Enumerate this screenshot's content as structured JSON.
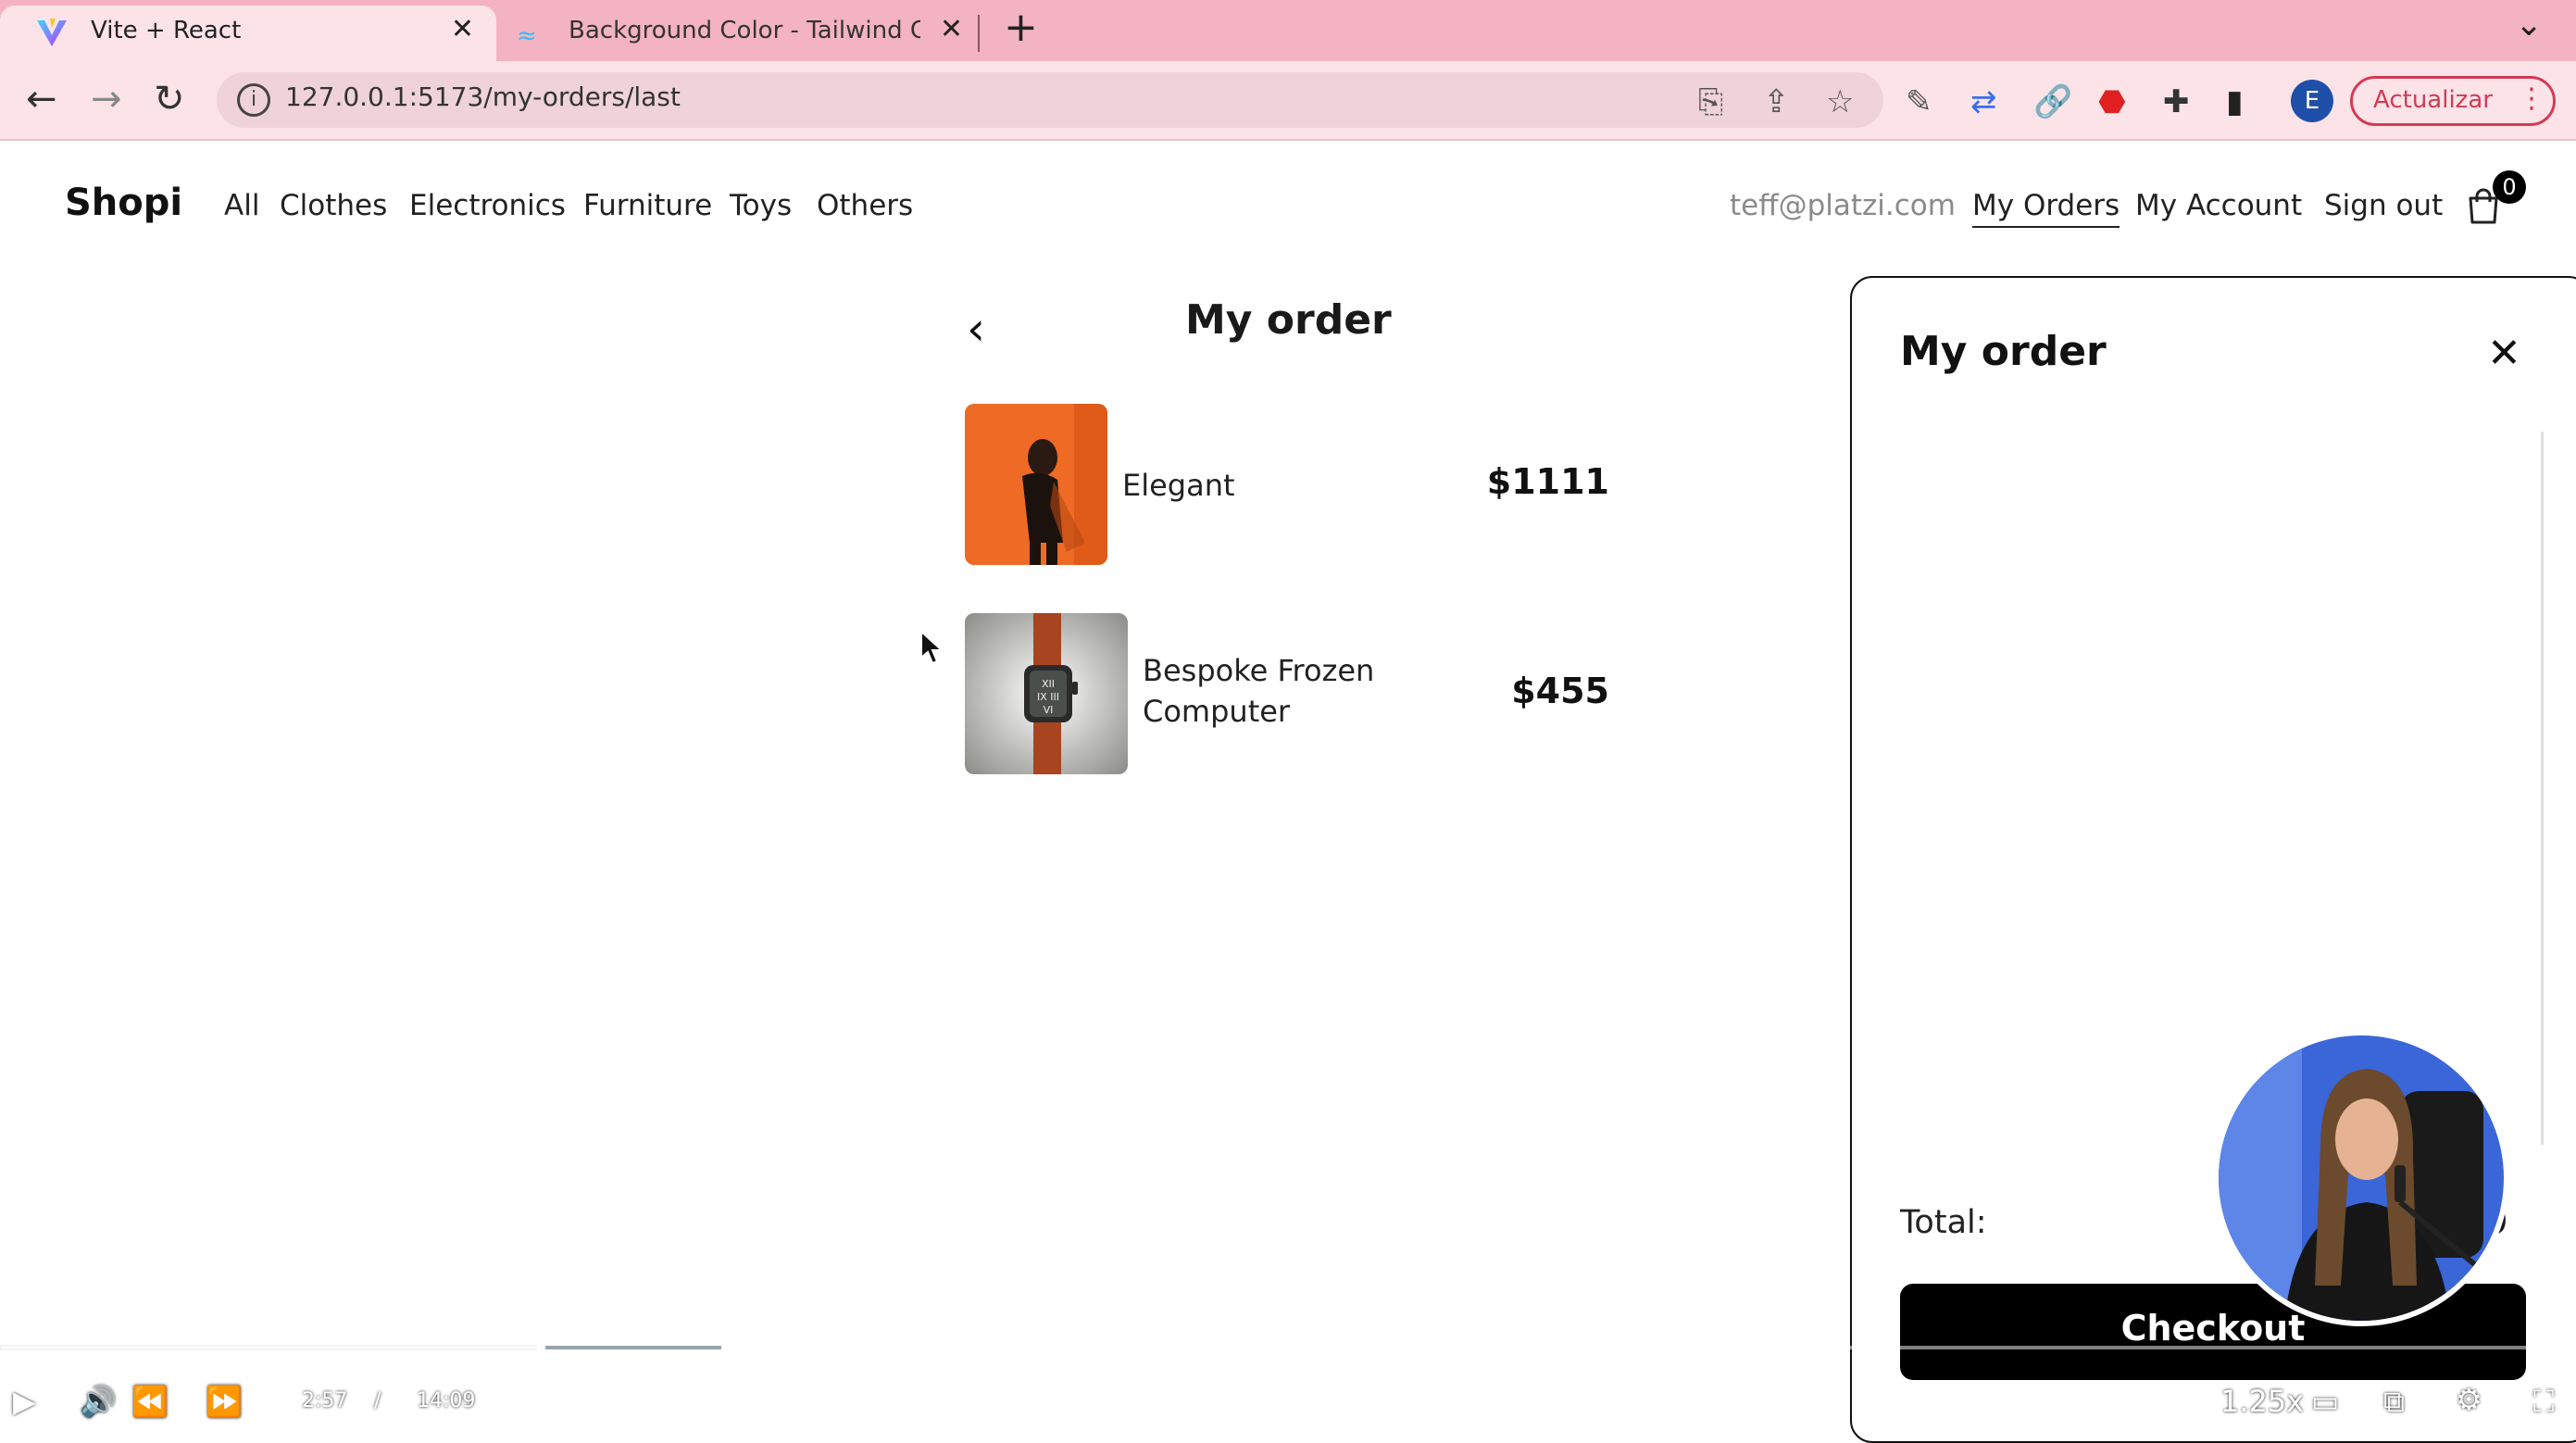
{
  "browser": {
    "tabs": [
      {
        "title": "Vite + React",
        "icon": "vite-icon"
      },
      {
        "title": "Background Color - Tailwind CSS",
        "icon": "tailwind-icon"
      }
    ],
    "url": "127.0.0.1:5173/my-orders/last",
    "update_button": "Actualizar",
    "profile_initial": "E",
    "colors": {
      "tab_strip": "#f4b3c2",
      "toolbar": "#fbe3e8",
      "update_red": "#d33a55"
    }
  },
  "nav": {
    "brand": "Shopi",
    "categories": [
      "All",
      "Clothes",
      "Electronics",
      "Furniture",
      "Toys",
      "Others"
    ],
    "email": "teff@platzi.com",
    "my_orders": "My Orders",
    "my_account": "My Account",
    "sign_out": "Sign out",
    "cart_count": "0"
  },
  "order": {
    "title": "My order",
    "items": [
      {
        "name": "Elegant",
        "price": "$1111"
      },
      {
        "name": "Bespoke Frozen Computer",
        "price": "$455"
      }
    ]
  },
  "side_panel": {
    "title": "My order",
    "total_label": "Total:",
    "total_value": "0",
    "checkout_label": "Checkout"
  },
  "video": {
    "current_time": "2:57",
    "separator": "/",
    "duration": "14:09",
    "speed": "1.25x",
    "played_fraction": 0.21,
    "buffered_fraction": 0.28
  }
}
